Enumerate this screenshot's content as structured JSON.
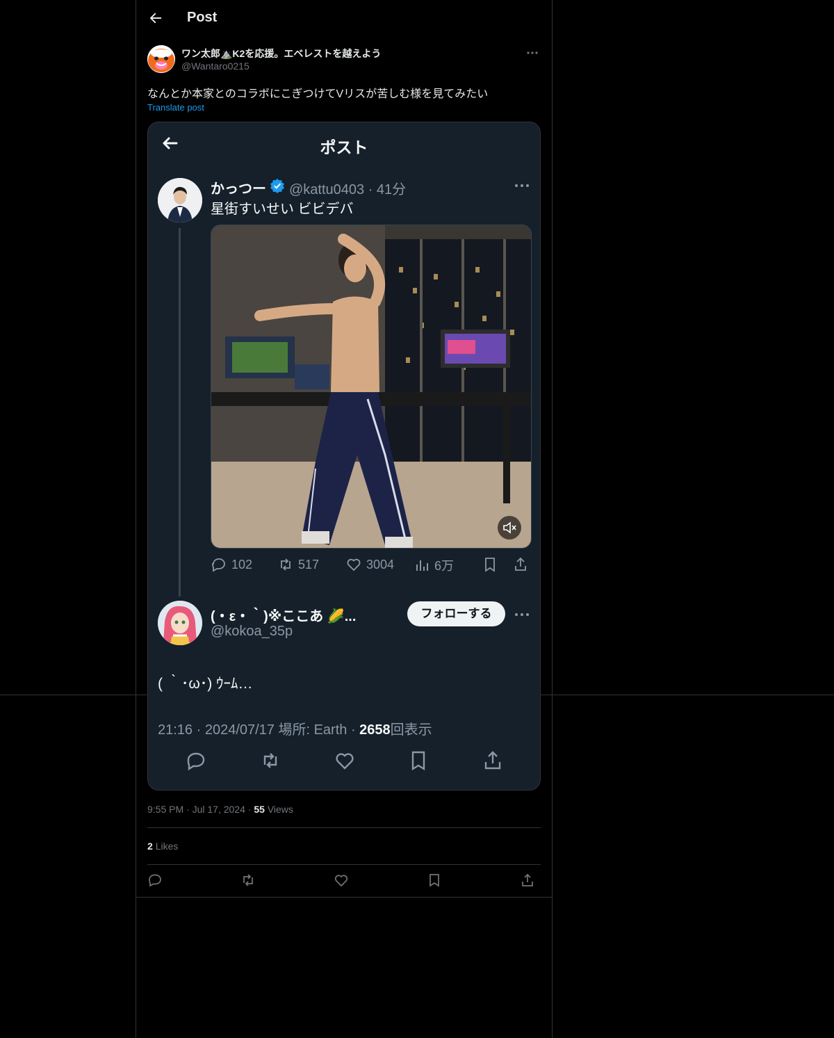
{
  "header": {
    "title": "Post"
  },
  "post": {
    "author_name": "ワン太郎⛰️K2を応援。エベレストを越えよう",
    "author_handle": "@Wantaro0215",
    "text": "なんとか本家とのコラボにこぎつけてVリスが苦しむ様を見てみたい",
    "translate_label": "Translate post",
    "time": "9:55 PM",
    "date": "Jul 17, 2024",
    "views_count": "55",
    "views_label": "Views",
    "likes_count": "2",
    "likes_label": "Likes"
  },
  "embed": {
    "title": "ポスト",
    "tweet1": {
      "name": "かっつー",
      "handle_time": "@kattu0403 · 41分",
      "text": "星街すいせい ビビデバ",
      "replies": "102",
      "retweets": "517",
      "likes": "3004",
      "views": "6万"
    },
    "tweet2": {
      "name": "(・ε・｀)※ここあ 🌽...",
      "handle": "@kokoa_35p",
      "follow_label": "フォローする",
      "text": "( ｀･ω･) ｳｰﾑ…",
      "meta_prefix": "21:16 · 2024/07/17 場所: Earth · ",
      "views_count": "2658",
      "views_label": "回表示"
    }
  },
  "colors": {
    "accent": "#1d9bf0",
    "background": "#000000",
    "embed_bg": "#15202b"
  }
}
